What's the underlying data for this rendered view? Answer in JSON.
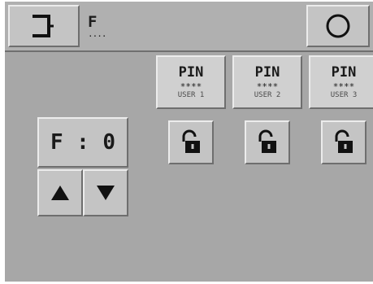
{
  "header": {
    "title": "F",
    "title_dots": "....",
    "back_icon": "exit-bracket-icon",
    "home_icon": "circle-icon"
  },
  "pins": [
    {
      "label": "PIN",
      "mask": "****",
      "user": "USER 1",
      "locked": false
    },
    {
      "label": "PIN",
      "mask": "****",
      "user": "USER 2",
      "locked": false
    },
    {
      "label": "PIN",
      "mask": "****",
      "user": "USER 3",
      "locked": false
    }
  ],
  "f_field": {
    "label": "F",
    "separator": ":",
    "value": "0"
  },
  "controls": {
    "up_icon": "triangle-up-icon",
    "down_icon": "triangle-down-icon",
    "lock_icon": "unlocked-padlock-icon"
  },
  "colors": {
    "panel": "#a7a7a7",
    "button": "#c4c4c4",
    "text": "#1a1a1a"
  }
}
